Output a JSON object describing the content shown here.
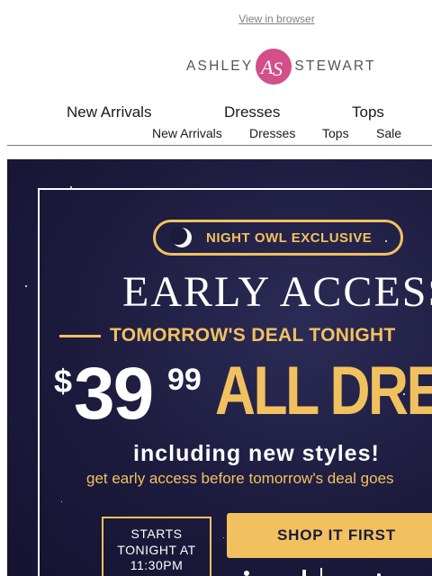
{
  "header": {
    "view_in_browser": "View in browser",
    "logo": {
      "left": "ASHLEY",
      "right": "STEWART",
      "mark": "AS"
    }
  },
  "nav_primary": [
    "New Arrivals",
    "Dresses",
    "Tops"
  ],
  "nav_secondary": [
    "New Arrivals",
    "Dresses",
    "Tops",
    "Sale"
  ],
  "hero": {
    "badge": "NIGHT OWL EXCLUSIVE",
    "headline": "EARLY ACCESS",
    "deal_line": "TOMORROW'S DEAL TONIGHT",
    "price_dollar": "$",
    "price_whole": "39",
    "price_cents": "99",
    "price_label": "ALL DRESSES",
    "including": "including new styles!",
    "early_access_line": "get early access before tomorrow's deal goes",
    "starts": {
      "line1": "STARTS",
      "line2": "TONIGHT AT",
      "line3": "11:30PM"
    },
    "cta": "SHOP IT FIRST"
  },
  "colors": {
    "accent_gold": "#f2c15f",
    "hero_background": "#1c1b3d",
    "logo_pink": "#d24f8a"
  },
  "icons": [
    "moon-icon",
    "ashley-stewart-logo-mark"
  ]
}
